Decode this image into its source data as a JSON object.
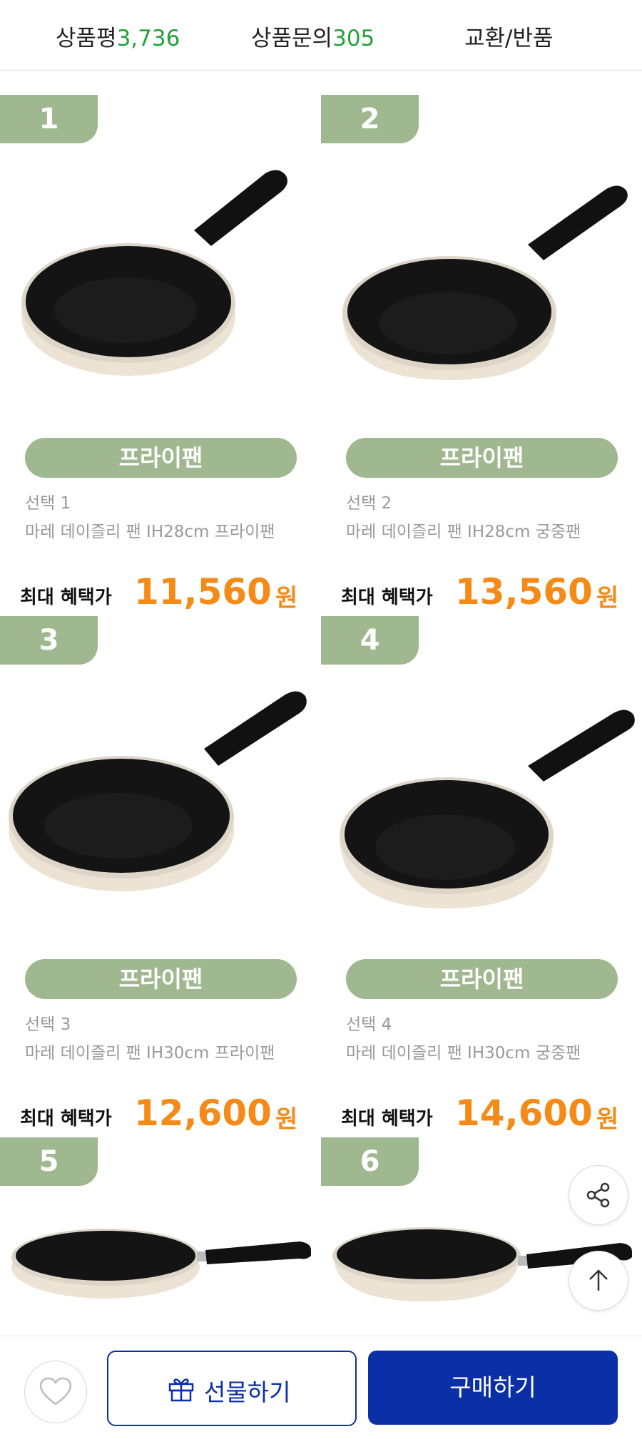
{
  "tabs": {
    "review": {
      "label": "상품평",
      "count": "3,736"
    },
    "inquiry": {
      "label": "상품문의",
      "count": "305"
    },
    "exchange": {
      "label": "교환/반품"
    }
  },
  "products": [
    {
      "number": "1",
      "category": "프라이팬",
      "option": "선택 1",
      "name": "마레 데이즐리 팬 IH28cm 프라이팬",
      "price_label": "최대 혜택가",
      "price": "11,560",
      "unit": "원"
    },
    {
      "number": "2",
      "category": "프라이팬",
      "option": "선택 2",
      "name": "마레 데이즐리 팬 IH28cm 궁중팬",
      "price_label": "최대 혜택가",
      "price": "13,560",
      "unit": "원"
    },
    {
      "number": "3",
      "category": "프라이팬",
      "option": "선택 3",
      "name": "마레 데이즐리 팬 IH30cm 프라이팬",
      "price_label": "최대 혜택가",
      "price": "12,600",
      "unit": "원"
    },
    {
      "number": "4",
      "category": "프라이팬",
      "option": "선택 4",
      "name": "마레 데이즐리 팬 IH30cm 궁중팬",
      "price_label": "최대 혜택가",
      "price": "14,600",
      "unit": "원"
    },
    {
      "number": "5"
    },
    {
      "number": "6"
    }
  ],
  "actions": {
    "gift": "선물하기",
    "buy": "구매하기"
  },
  "icons": {
    "wish": "heart-icon",
    "gift": "gift-icon",
    "share": "share-icon",
    "top": "arrow-up-icon"
  },
  "colors": {
    "accent_green": "#9fb88f",
    "count_green": "#21a33a",
    "price_orange": "#f58a17",
    "primary_blue": "#0a2fa6"
  }
}
